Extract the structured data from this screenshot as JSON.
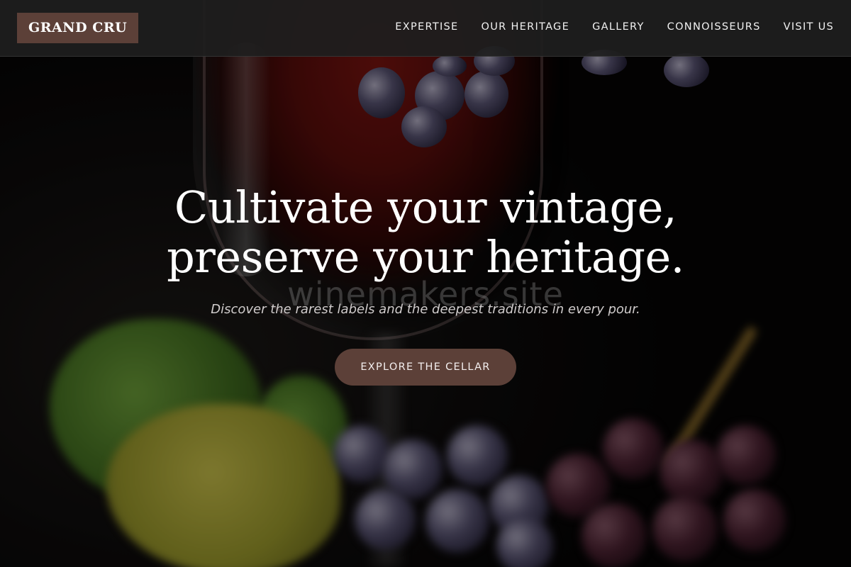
{
  "header": {
    "brand": "GRAND CRU",
    "nav": [
      {
        "label": "EXPERTISE"
      },
      {
        "label": "OUR HERITAGE"
      },
      {
        "label": "GALLERY"
      },
      {
        "label": "CONNOISSEURS"
      },
      {
        "label": "VISIT US"
      }
    ]
  },
  "hero": {
    "headline_line1": "Cultivate your vintage,",
    "headline_line2": "preserve your heritage.",
    "watermark": "winemakers.site",
    "subline": "Discover the rarest labels and the deepest traditions in every pour.",
    "cta_label": "EXPLORE THE CELLAR"
  },
  "colors": {
    "accent": "#5c4038",
    "header_bg": "#1e1e1e",
    "text": "#ffffff"
  }
}
